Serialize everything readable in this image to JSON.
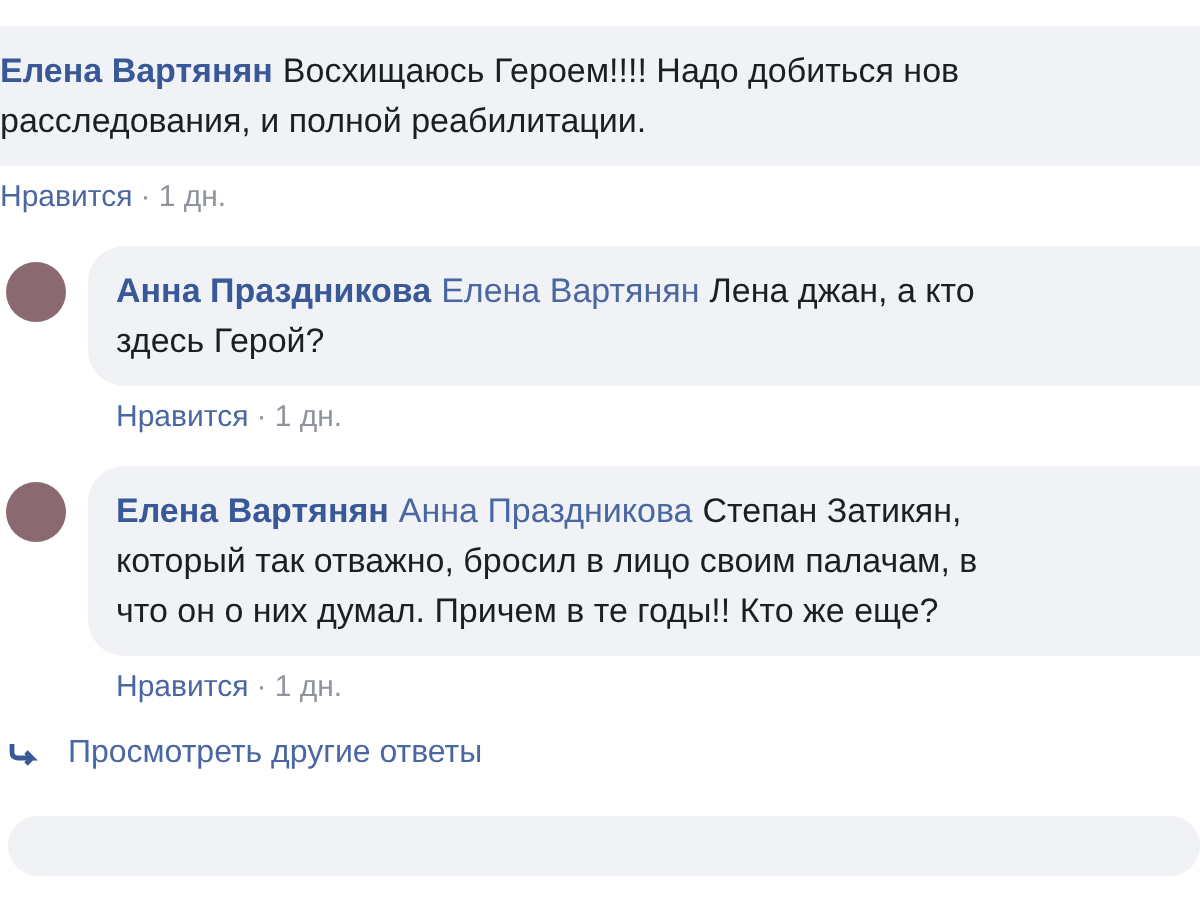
{
  "comments": [
    {
      "author": "Елена Вартянян",
      "kind": "comment",
      "lines": [
        "Восхищаюсь Героем!!!! Надо добиться нов",
        "расследования, и полной реабилитации."
      ],
      "like": "Нравится",
      "time": "· 1 дн."
    },
    {
      "author": "Анна Праздникова",
      "kind": "reply",
      "mention": "Елена Вартянян",
      "lines": [
        "Лена джан, а кто",
        "здесь Герой?"
      ],
      "like": "Нравится",
      "time": "· 1 дн."
    },
    {
      "author": "Елена Вартянян",
      "kind": "reply",
      "mention": "Анна Праздникова",
      "lines": [
        "Степан Затикян,",
        "который так отважно, бросил в лицо своим палачам, в",
        "что он о них думал. Причем в те годы!! Кто же еще?"
      ],
      "like": "Нравится",
      "time": "· 1 дн."
    }
  ],
  "more_replies": "Просмотреть другие ответы"
}
